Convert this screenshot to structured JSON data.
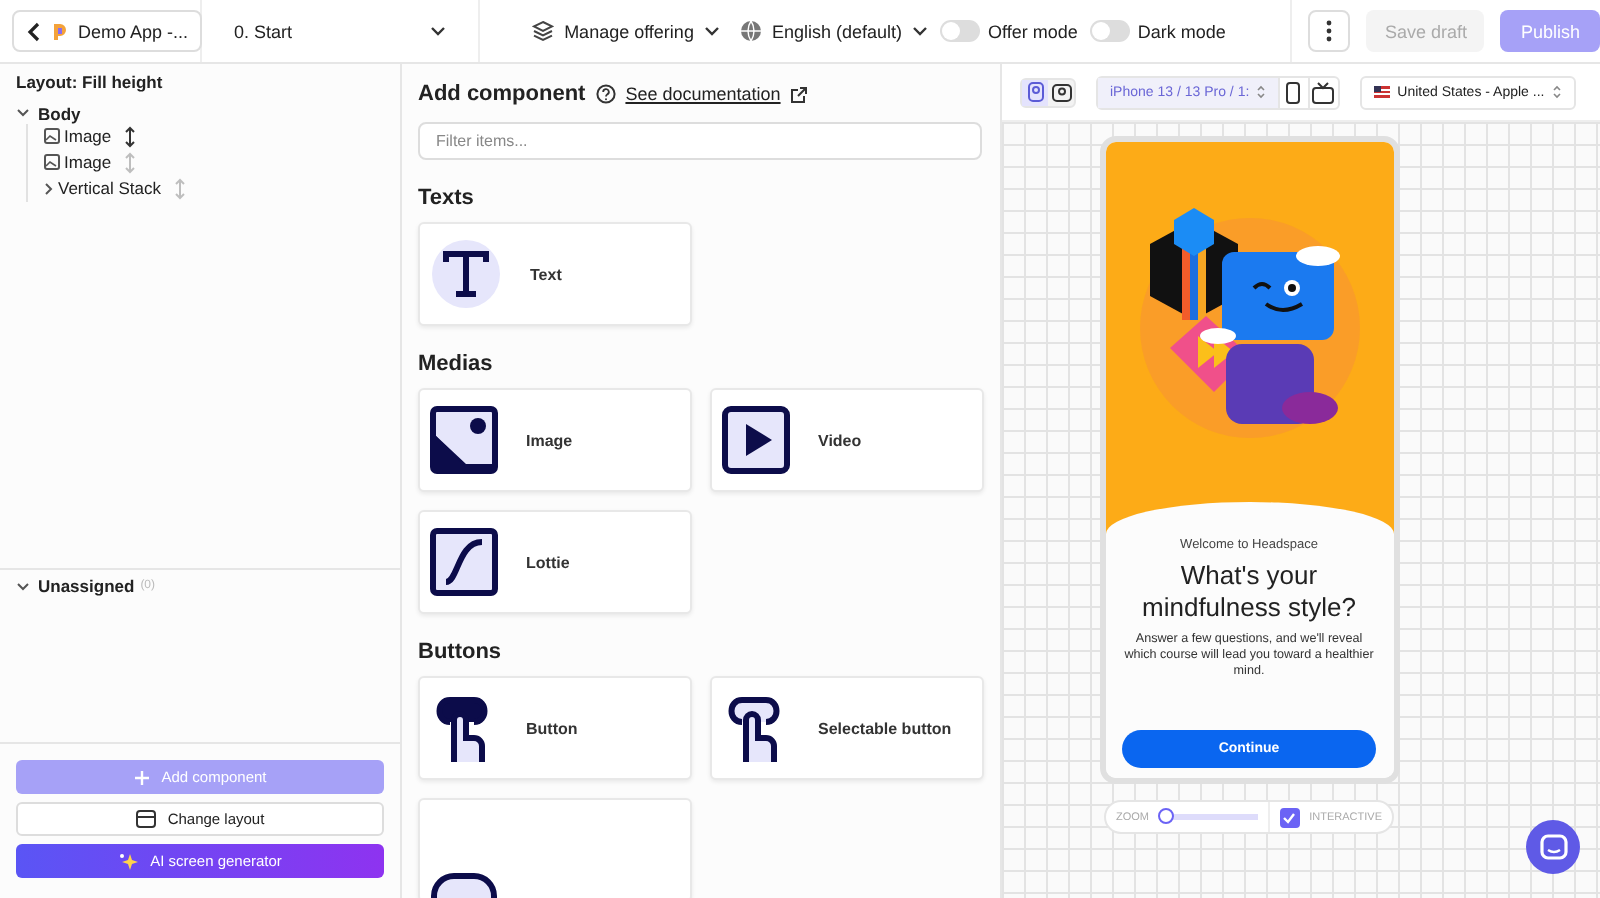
{
  "topbar": {
    "app_name": "Demo App -...",
    "screen": "0. Start",
    "manage": "Manage offering",
    "language": "English (default)",
    "toggles": [
      {
        "label": "Offer mode",
        "on": false
      },
      {
        "label": "Dark mode",
        "on": false
      }
    ],
    "save": "Save draft",
    "publish": "Publish"
  },
  "layers": {
    "layout": "Layout: Fill height",
    "tree": [
      {
        "label": "Body",
        "expanded": true,
        "children": [
          {
            "label": "Image",
            "kind": "image",
            "active": true
          },
          {
            "label": "Image",
            "kind": "image",
            "active": false
          },
          {
            "label": "Vertical Stack",
            "kind": "stack",
            "expanded": false,
            "active": false
          }
        ]
      }
    ],
    "unassigned": {
      "label": "Unassigned",
      "count": "(0)",
      "expanded": true
    },
    "buttons": [
      {
        "label": "Add component",
        "kind": "primary"
      },
      {
        "label": "Change layout",
        "kind": "outline"
      },
      {
        "label": "AI screen generator",
        "kind": "gradient"
      }
    ]
  },
  "components": {
    "title": "Add component",
    "doc_link": "See documentation",
    "filter": {
      "placeholder": "Filter items..."
    },
    "sections": [
      {
        "title": "Texts",
        "items": [
          {
            "label": "Text",
            "kind": "text"
          }
        ]
      },
      {
        "title": "Medias",
        "items": [
          {
            "label": "Image",
            "kind": "image"
          },
          {
            "label": "Video",
            "kind": "video"
          },
          {
            "label": "Lottie",
            "kind": "lottie"
          }
        ]
      },
      {
        "title": "Buttons",
        "items": [
          {
            "label": "Button",
            "kind": "button"
          },
          {
            "label": "Selectable button",
            "kind": "selectable"
          },
          {
            "kind": "partial"
          }
        ]
      }
    ]
  },
  "preview": {
    "orientations": [
      {
        "kind": "portrait",
        "selected": true
      },
      {
        "kind": "landscape",
        "selected": false
      }
    ],
    "device": "iPhone 13 / 13 Pro / 1:",
    "store": "United States - Apple ...",
    "phone": {
      "eyebrow": "Welcome to Headspace",
      "headline": "What's your mindfulness style?",
      "body": "Answer a few questions, and we'll reveal which course will lead you toward a healthier mind.",
      "cta": "Continue"
    },
    "zoom": {
      "label": "ZOOM",
      "level": 0.08
    },
    "interactive": {
      "label": "INTERACTIVE",
      "checked": true
    }
  }
}
